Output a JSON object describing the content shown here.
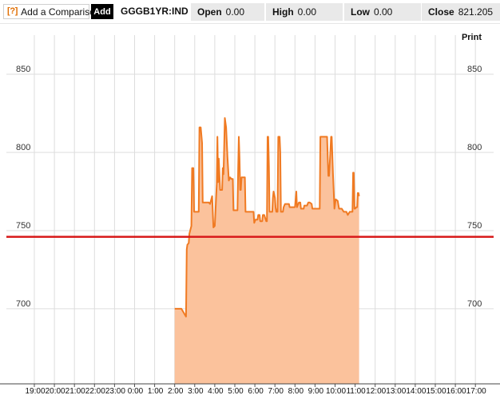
{
  "toolbar": {
    "help_icon": "[?]",
    "compare_label": "Add a Comparison",
    "add_label": "Add",
    "symbol": "GGGB1YR:IND",
    "open_label": "Open",
    "open_value": "0.00",
    "high_label": "High",
    "high_value": "0.00",
    "low_label": "Low",
    "low_value": "0.00",
    "close_label": "Close",
    "close_value": "821.205"
  },
  "print_label": "Print",
  "colors": {
    "line": "#f07a22",
    "area": "#fbc29c",
    "reference_line": "#d81b1b",
    "grid": "#dddddd"
  },
  "chart_data": {
    "type": "area",
    "ylim": [
      652,
      875
    ],
    "y_ticks": [
      700,
      750,
      800,
      850
    ],
    "x_tick_labels": [
      "19:00",
      "20:00",
      "21:00",
      "22:00",
      "23:00",
      "0:00",
      "1:00",
      "2:00",
      "3:00",
      "4:00",
      "5:00",
      "6:00",
      "7:00",
      "8:00",
      "9:00",
      "10:00",
      "11:00",
      "12:00",
      "13:00",
      "14:00",
      "15:00",
      "16:00",
      "17:00"
    ],
    "reference_value": 746,
    "series": [
      {
        "values": [
          [
            "2:00",
            700
          ],
          [
            "2:20",
            700
          ],
          [
            "2:34",
            695
          ],
          [
            "2:36",
            738
          ],
          [
            "2:38",
            741
          ],
          [
            "2:42",
            742
          ],
          [
            "2:44",
            748
          ],
          [
            "2:50",
            753
          ],
          [
            "2:52",
            790
          ],
          [
            "2:56",
            790
          ],
          [
            "2:58",
            762
          ],
          [
            "3:12",
            762
          ],
          [
            "3:14",
            816
          ],
          [
            "3:18",
            816
          ],
          [
            "3:22",
            806
          ],
          [
            "3:24",
            768
          ],
          [
            "3:42",
            768
          ],
          [
            "3:46",
            767
          ],
          [
            "3:52",
            772
          ],
          [
            "3:56",
            752
          ],
          [
            "4:00",
            753
          ],
          [
            "4:06",
            780
          ],
          [
            "4:08",
            810
          ],
          [
            "4:10",
            781
          ],
          [
            "4:12",
            796
          ],
          [
            "4:16",
            776
          ],
          [
            "4:22",
            776
          ],
          [
            "4:24",
            790
          ],
          [
            "4:26",
            786
          ],
          [
            "4:28",
            802
          ],
          [
            "4:30",
            822
          ],
          [
            "4:34",
            816
          ],
          [
            "4:38",
            797
          ],
          [
            "4:42",
            782
          ],
          [
            "4:46",
            784
          ],
          [
            "4:50",
            783
          ],
          [
            "4:54",
            783
          ],
          [
            "4:56",
            763
          ],
          [
            "5:08",
            763
          ],
          [
            "5:10",
            790
          ],
          [
            "5:12",
            810
          ],
          [
            "5:14",
            796
          ],
          [
            "5:16",
            776
          ],
          [
            "5:18",
            776
          ],
          [
            "5:20",
            784
          ],
          [
            "5:30",
            784
          ],
          [
            "5:32",
            762
          ],
          [
            "5:56",
            762
          ],
          [
            "5:58",
            755
          ],
          [
            "6:02",
            757
          ],
          [
            "6:08",
            757
          ],
          [
            "6:10",
            760
          ],
          [
            "6:14",
            760
          ],
          [
            "6:16",
            756
          ],
          [
            "6:22",
            756
          ],
          [
            "6:24",
            760
          ],
          [
            "6:28",
            760
          ],
          [
            "6:34",
            756
          ],
          [
            "6:36",
            756
          ],
          [
            "6:38",
            810
          ],
          [
            "6:40",
            810
          ],
          [
            "6:42",
            791
          ],
          [
            "6:44",
            762
          ],
          [
            "6:52",
            762
          ],
          [
            "6:54",
            771
          ],
          [
            "6:56",
            775
          ],
          [
            "7:00",
            771
          ],
          [
            "7:02",
            765
          ],
          [
            "7:04",
            762
          ],
          [
            "7:08",
            762
          ],
          [
            "7:10",
            810
          ],
          [
            "7:14",
            810
          ],
          [
            "7:16",
            800
          ],
          [
            "7:18",
            762
          ],
          [
            "7:24",
            762
          ],
          [
            "7:26",
            765
          ],
          [
            "7:30",
            767
          ],
          [
            "7:42",
            767
          ],
          [
            "7:44",
            765
          ],
          [
            "7:48",
            765
          ],
          [
            "7:54",
            765
          ],
          [
            "8:00",
            765
          ],
          [
            "8:04",
            775
          ],
          [
            "8:06",
            765
          ],
          [
            "8:08",
            766
          ],
          [
            "8:12",
            768
          ],
          [
            "8:16",
            768
          ],
          [
            "8:18",
            764
          ],
          [
            "8:26",
            764
          ],
          [
            "8:28",
            766
          ],
          [
            "8:36",
            766
          ],
          [
            "8:40",
            768
          ],
          [
            "8:44",
            768
          ],
          [
            "8:50",
            767
          ],
          [
            "8:52",
            764
          ],
          [
            "9:12",
            764
          ],
          [
            "9:14",
            764
          ],
          [
            "9:16",
            810
          ],
          [
            "9:36",
            810
          ],
          [
            "9:40",
            785
          ],
          [
            "9:42",
            785
          ],
          [
            "9:46",
            800
          ],
          [
            "9:48",
            810
          ],
          [
            "9:50",
            810
          ],
          [
            "9:54",
            785
          ],
          [
            "9:58",
            764
          ],
          [
            "10:02",
            770
          ],
          [
            "10:08",
            769
          ],
          [
            "10:12",
            764
          ],
          [
            "10:20",
            764
          ],
          [
            "10:26",
            762
          ],
          [
            "10:34",
            762
          ],
          [
            "10:38",
            760
          ],
          [
            "10:44",
            762
          ],
          [
            "10:48",
            762
          ],
          [
            "10:52",
            762
          ],
          [
            "10:54",
            787
          ],
          [
            "10:56",
            787
          ],
          [
            "10:58",
            764
          ],
          [
            "11:00",
            764
          ],
          [
            "11:04",
            765
          ],
          [
            "11:06",
            765
          ],
          [
            "11:08",
            774
          ],
          [
            "11:10",
            774
          ],
          [
            "11:12",
            772
          ]
        ]
      }
    ]
  }
}
